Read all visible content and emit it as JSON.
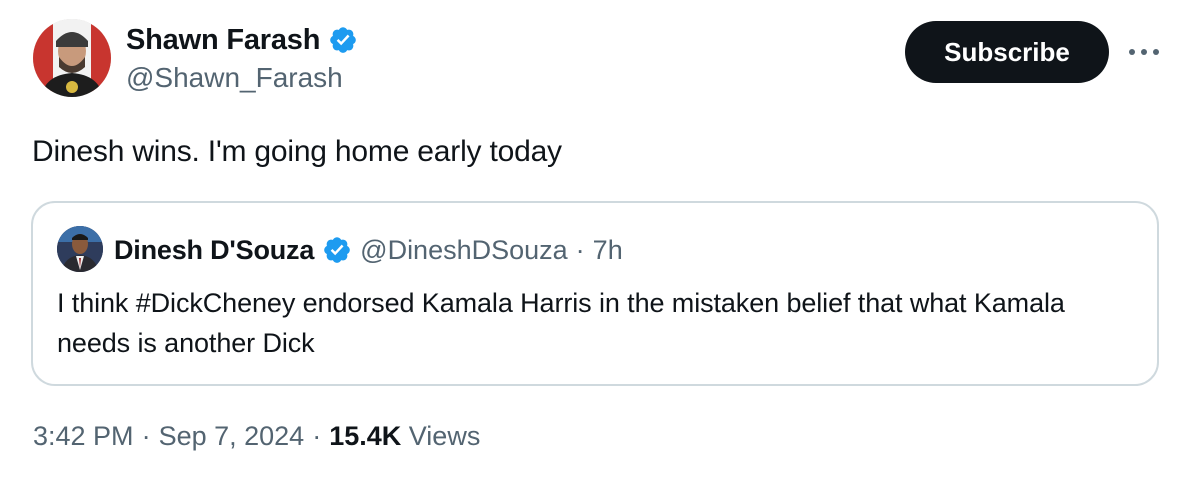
{
  "author": {
    "name": "Shawn Farash",
    "handle": "@Shawn_Farash"
  },
  "actions": {
    "subscribe_label": "Subscribe"
  },
  "tweet": {
    "text": "Dinesh wins. I'm going home early today"
  },
  "quote": {
    "name": "Dinesh D'Souza",
    "handle": "@DineshDSouza",
    "separator": "·",
    "time": "7h",
    "text": "I think #DickCheney endorsed Kamala Harris in the mistaken belief that what Kamala needs is another Dick"
  },
  "meta": {
    "time": "3:42 PM",
    "separator": "·",
    "date": "Sep 7, 2024",
    "separator2": "·",
    "views_count": "15.4K",
    "views_label": "Views"
  },
  "colors": {
    "verified_blue": "#1d9bf0",
    "button_bg": "#0f1419",
    "secondary_text": "#536471",
    "border": "#cfd9de"
  },
  "icons": {
    "verified": "verified-badge-icon",
    "more": "more-options-icon"
  }
}
